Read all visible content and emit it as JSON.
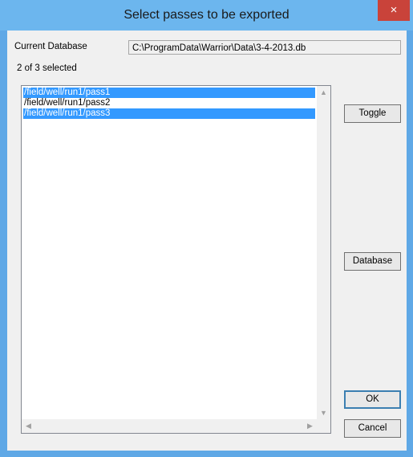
{
  "window": {
    "title": "Select passes to be exported",
    "close_glyph": "×"
  },
  "database": {
    "label": "Current Database",
    "path": "C:\\ProgramData\\Warrior\\Data\\3-4-2013.db"
  },
  "selection_status": "2 of 3 selected",
  "passes": [
    {
      "label": "/field/well/run1/pass1",
      "selected": true
    },
    {
      "label": "/field/well/run1/pass2",
      "selected": false
    },
    {
      "label": "/field/well/run1/pass3",
      "selected": true
    }
  ],
  "buttons": {
    "toggle": "Toggle",
    "database": "Database",
    "ok": "OK",
    "cancel": "Cancel"
  },
  "scrollbar": {
    "up": "▲",
    "down": "▼",
    "left": "◀",
    "right": "▶"
  }
}
